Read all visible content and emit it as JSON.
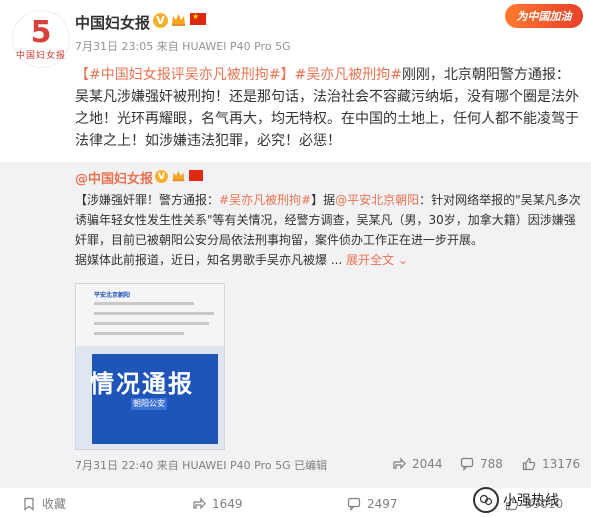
{
  "post": {
    "author": "中国妇女报",
    "meta": "7月31日 23:05 来自 HUAWEI P40 Pro 5G",
    "banner": "为中国加油",
    "avatar_char": "ʃ",
    "avatar_text": "中国妇女报",
    "text": {
      "hashtag1": "【#中国妇女报评吴亦凡被刑拘#】",
      "hashtag2": "#吴亦凡被刑拘#",
      "body": "刚刚，北京朝阳警方通报：吴某凡涉嫌强奸被刑拘！还是那句话，法治社会不容藏污纳垢，没有哪个圈是法外之地！光环再耀眼，名气再大，均无特权。在中国的土地上，任何人都不能凌驾于法律之上！如涉嫌违法犯罪，必究！必惩！"
    }
  },
  "repost": {
    "author": "@中国妇女报",
    "text1": "【涉嫌强奸罪！警方通报：",
    "hashtag": "#吴亦凡被刑拘#",
    "text2": "】据",
    "mention": "@平安北京朝阳",
    "text3": "：针对网络举报的\"吴某凡多次诱骗年轻女性发生性关系\"等有关情况，经警方调查，吴某凡（男，30岁，加拿大籍）因涉嫌强奸罪，目前已被朝阳公安分局依法刑事拘留，案件侦办工作正在进一步开展。",
    "text4": "据媒体此前报道，近日，知名男歌手吴亦凡被爆 ...",
    "expand": "展开全文",
    "image": {
      "header_title": "平安北京朝阳",
      "big_text": "情况通报",
      "sub_text": "朝阳公安"
    },
    "meta": "7月31日 22:40 来自 HUAWEI P40 Pro 5G  已编辑",
    "shares": "2044",
    "comments": "788",
    "likes": "13176"
  },
  "actions": {
    "collect": "收藏",
    "shares": "1649",
    "comments": "2497",
    "likes": "39010"
  },
  "watermark": "小强热线"
}
